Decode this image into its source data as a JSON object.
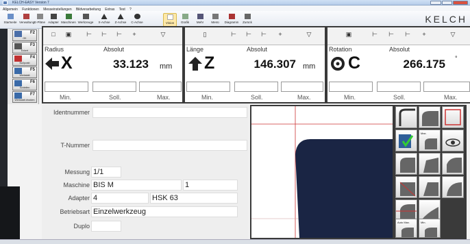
{
  "window": {
    "title": "KELCH-EASY Version 7"
  },
  "menu": [
    "Allgemein",
    "Funktionen",
    "Messeinstellungen",
    "Bildverarbeitung",
    "Extras",
    "Test",
    "?"
  ],
  "ribbon": [
    "Startseite",
    "Verwaltung",
    "E-Pläne",
    "Adapter",
    "Maschinen",
    "Werkzeuge",
    "X-Achse",
    "Z-Achse",
    "C-Achse",
    "Vision",
    "Grafik",
    "Mehr",
    "Menü",
    "Diagramm",
    "Zurück"
  ],
  "brand": "KELCH",
  "fkeys": [
    {
      "key": "F2",
      "label": "OK"
    },
    {
      "key": "F3",
      "label": "Exkert"
    },
    {
      "key": "F4",
      "label": "Nullpunkt"
    },
    {
      "key": "F5",
      "label": "Werkstatt"
    },
    {
      "key": "F6",
      "label": "Schleifen"
    },
    {
      "key": "F7",
      "label": "Werkstatt drucken"
    }
  ],
  "axes": [
    {
      "mode": "Radius",
      "ref": "Absolut",
      "name": "X",
      "value": "33.123",
      "unit": "mm",
      "min": "Min.",
      "soll": "Soll.",
      "max": "Max."
    },
    {
      "mode": "Länge",
      "ref": "Absolut",
      "name": "Z",
      "value": "146.307",
      "unit": "mm",
      "min": "Min.",
      "soll": "Soll.",
      "max": "Max."
    },
    {
      "mode": "Rotation",
      "ref": "Absolut",
      "name": "C",
      "value": "266.175",
      "unit": "°",
      "min": "Min.",
      "soll": "Soll.",
      "max": "Max."
    }
  ],
  "form": {
    "ident_label": "Identnummer",
    "ident_value": "",
    "tnum_label": "T-Nummer",
    "tnum_value": "",
    "messung_label": "Messung",
    "messung_value": "1/1",
    "maschine_label": "Maschine",
    "maschine_value": "BIS M",
    "maschine_extra": "1",
    "adapter_label": "Adapter",
    "adapter_value": "4",
    "adapter_extra": "HSK 63",
    "betrieb_label": "Betriebsart",
    "betrieb_value": "Einzelwerkzeug",
    "duplo_label": "Duplo",
    "duplo_value": ""
  },
  "tiles": [
    "",
    "",
    "",
    "",
    "Max.",
    "",
    "",
    "",
    "",
    "",
    "",
    "",
    "",
    "",
    "",
    "Auto Max.",
    "Min."
  ],
  "colors": {
    "tool": "#1a2544",
    "crosshair": "#cc3333"
  }
}
